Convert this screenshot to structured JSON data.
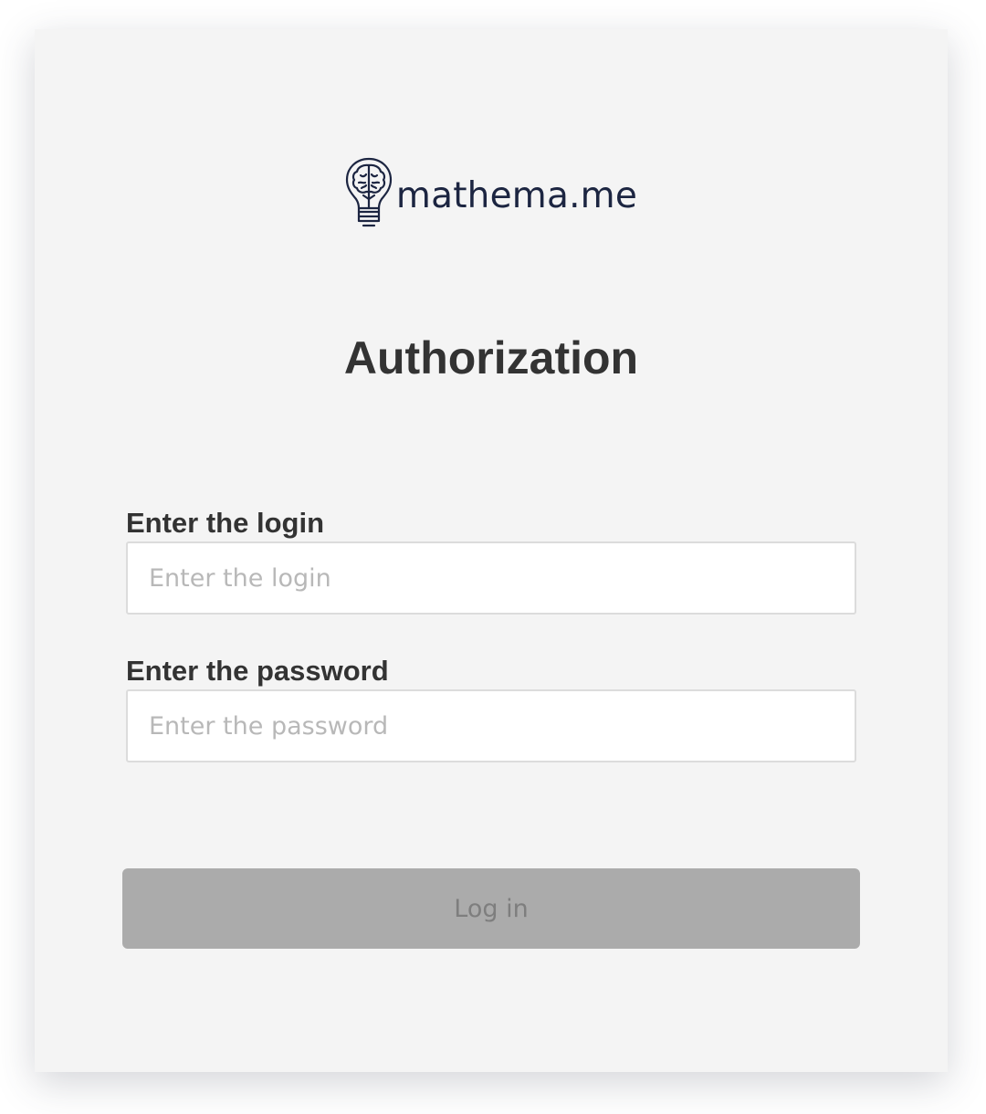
{
  "brand": {
    "name": "mathema.me",
    "icon": "lightbulb-brain-icon",
    "color": "#1c2541"
  },
  "page": {
    "title": "Authorization"
  },
  "form": {
    "login": {
      "label": "Enter the login",
      "placeholder": "Enter the login",
      "value": ""
    },
    "password": {
      "label": "Enter the password",
      "placeholder": "Enter the password",
      "value": ""
    },
    "submit": {
      "label": "Log in",
      "enabled": false
    }
  }
}
